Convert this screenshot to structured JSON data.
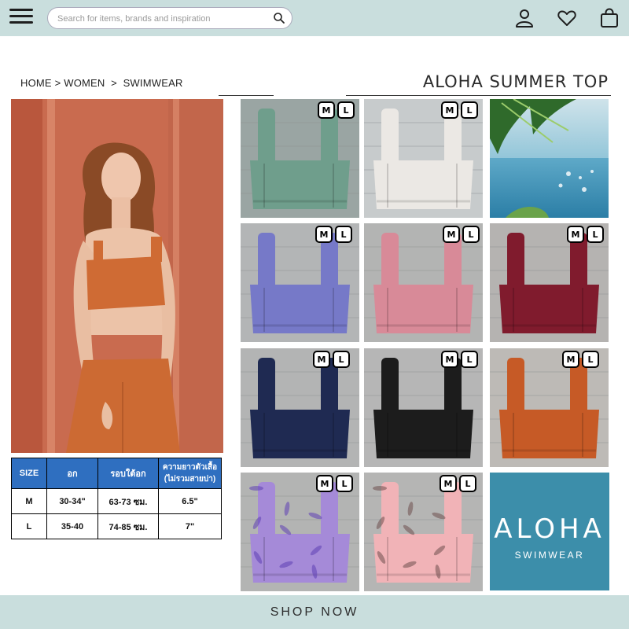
{
  "header": {
    "search_placeholder": "Search for items, brands and inspiration",
    "icons": [
      "menu-icon",
      "search-icon",
      "account-icon",
      "wishlist-heart-icon",
      "shopping-bag-icon"
    ],
    "bar_color": "#c9dedd"
  },
  "breadcrumb": {
    "home": "HOME",
    "women": "WOMEN",
    "swimwear": "SWIMWEAR",
    "separator": ">"
  },
  "product": {
    "title": "ALOHA SUMMER TOP"
  },
  "size_table": {
    "headers": [
      "SIZE",
      "อก",
      "รอบใต้อก",
      "ความยาวตัวเสื้อ (ไม่รวมสายบ่า)"
    ],
    "rows": [
      [
        "M",
        "30-34\"",
        "63-73 ซม.",
        "6.5\""
      ],
      [
        "L",
        "35-40",
        "74-85 ซม.",
        "7\""
      ]
    ],
    "header_color": "#2f6fc0"
  },
  "swatches": [
    {
      "color": "#6f9e8c",
      "bg": "#9aa5a3",
      "sizes": [
        "M",
        "L"
      ]
    },
    {
      "color": "#ebe8e4",
      "bg": "#c7cbcc",
      "sizes": [
        "M",
        "L"
      ]
    },
    {
      "color": "#7679c8",
      "bg": "#b3b5b6",
      "sizes": [
        "M",
        "L"
      ]
    },
    {
      "color": "#d88a98",
      "bg": "#b3b4b3",
      "sizes": [
        "M",
        "L"
      ]
    },
    {
      "color": "#801b2d",
      "bg": "#b5b3b1",
      "sizes": [
        "M",
        "L"
      ]
    },
    {
      "color": "#1f2a52",
      "bg": "#b3b4b4",
      "sizes": [
        "M",
        "L"
      ]
    },
    {
      "color": "#1c1c1c",
      "bg": "#b6b6b6",
      "sizes": [
        "M",
        "L"
      ]
    },
    {
      "color": "#c65a26",
      "bg": "#bdbab6",
      "sizes": [
        "M",
        "L"
      ]
    },
    {
      "color": "#a58ad8",
      "bg": "#b3b4b3",
      "sizes": [
        "M",
        "L"
      ]
    },
    {
      "color": "#f1b3b7",
      "bg": "#b5b5b4",
      "sizes": [
        "M",
        "L"
      ]
    }
  ],
  "brand": {
    "name": "ALOHA",
    "tagline": "SWIMWEAR",
    "color": "#3c8eaa"
  },
  "cta": {
    "label": "SHOP NOW"
  },
  "accent": "#cc6a3a"
}
